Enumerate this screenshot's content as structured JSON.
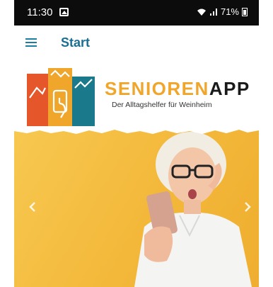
{
  "status_bar": {
    "time": "11:30",
    "battery": "71%",
    "icons": [
      "image-icon",
      "wifi-icon",
      "signal-icon",
      "battery-icon"
    ]
  },
  "app_bar": {
    "title": "Start",
    "menu_icon": "hamburger-menu-icon"
  },
  "banner": {
    "brand_part_a": "SENIOREN",
    "brand_part_b": "APP",
    "tagline": "Der Alltagshelfer für Weinheim"
  },
  "hero": {
    "prev_icon": "chevron-left-icon",
    "next_icon": "chevron-right-icon"
  },
  "colors": {
    "accent": "#1a7fa0",
    "brand_orange": "#f0a52b",
    "hero_yellow": "#f5be3f",
    "logo_red": "#e5562a",
    "logo_teal": "#1a7a8c"
  }
}
